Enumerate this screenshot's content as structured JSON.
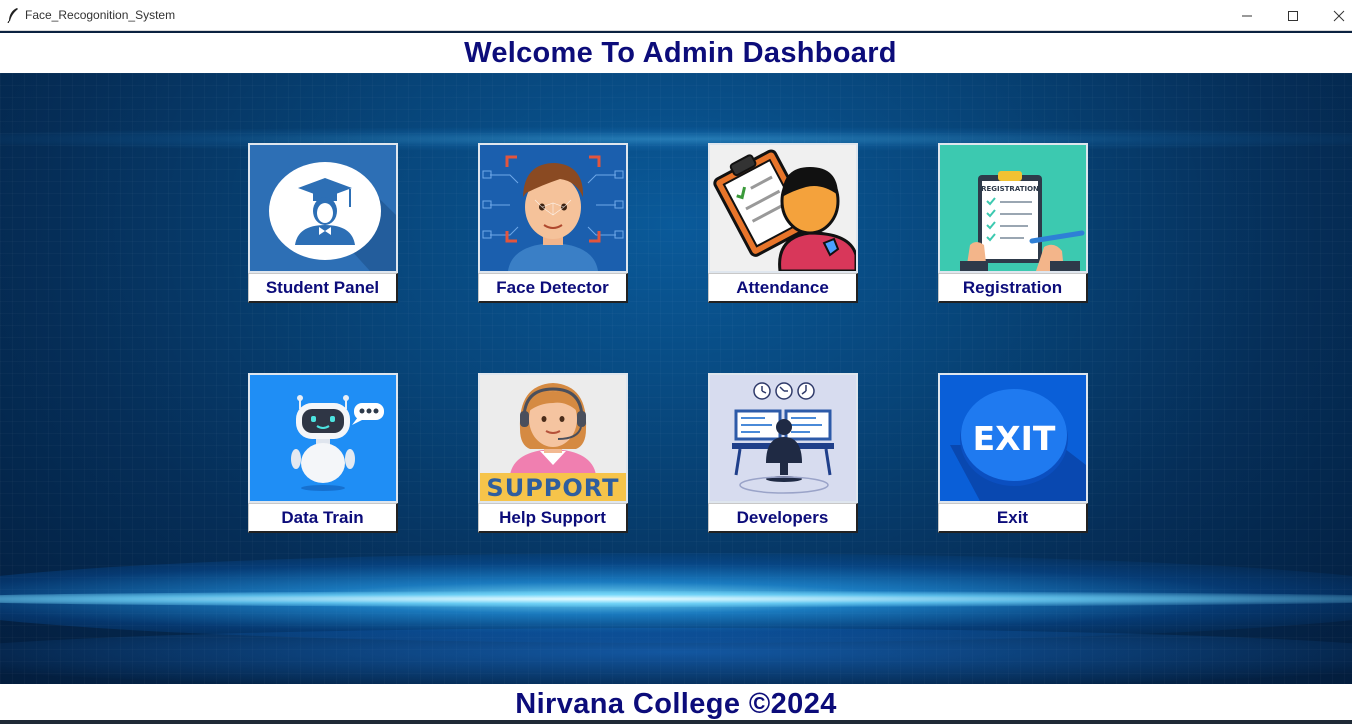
{
  "window": {
    "title": "Face_Recogonition_System",
    "controls": {
      "minimize": "minimize",
      "maximize": "maximize",
      "close": "close"
    }
  },
  "header": {
    "title": "Welcome To Admin Dashboard"
  },
  "tiles": [
    {
      "label": "Student Panel",
      "icon": "graduate-icon"
    },
    {
      "label": "Face Detector",
      "icon": "face-scan-icon"
    },
    {
      "label": "Attendance",
      "icon": "clipboard-person-icon"
    },
    {
      "label": "Registration",
      "icon": "registration-form-icon"
    },
    {
      "label": "Data Train",
      "icon": "robot-icon"
    },
    {
      "label": "Help Support",
      "icon": "support-agent-icon",
      "image_text": "SUPPORT"
    },
    {
      "label": "Developers",
      "icon": "developers-icon"
    },
    {
      "label": "Exit",
      "icon": "exit-icon",
      "image_text": "EXIT"
    }
  ],
  "registration_image_text": "REGISTRATION",
  "footer": {
    "text": "Nirvana College ©2024"
  },
  "colors": {
    "title_text": "#0c0c7a",
    "background": "#074478",
    "glow": "#6fdcff"
  }
}
